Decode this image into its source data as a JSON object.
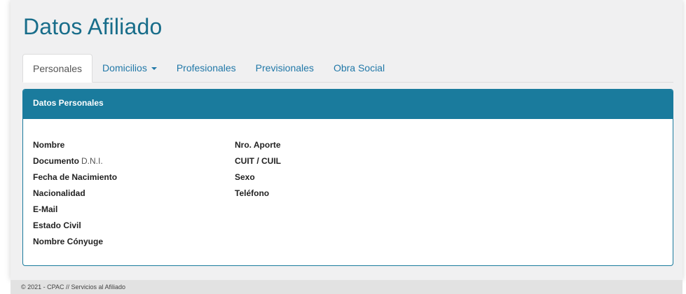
{
  "page": {
    "title": "Datos Afiliado"
  },
  "tabs": [
    {
      "label": "Personales",
      "active": true
    },
    {
      "label": "Domicilios",
      "dropdown": true
    },
    {
      "label": "Profesionales"
    },
    {
      "label": "Previsionales"
    },
    {
      "label": "Obra Social"
    }
  ],
  "panel": {
    "heading": "Datos Personales",
    "left_fields": [
      {
        "label": "Nombre",
        "value": ""
      },
      {
        "label": "Documento",
        "value": "D.N.I."
      },
      {
        "label": "Fecha de Nacimiento",
        "value": ""
      },
      {
        "label": "Nacionalidad",
        "value": ""
      },
      {
        "label": "E-Mail",
        "value": ""
      },
      {
        "label": "Estado Civil",
        "value": ""
      },
      {
        "label": "Nombre Cónyuge",
        "value": ""
      }
    ],
    "right_fields": [
      {
        "label": "Nro. Aporte",
        "value": ""
      },
      {
        "label": "CUIT / CUIL",
        "value": ""
      },
      {
        "label": "Sexo",
        "value": ""
      },
      {
        "label": "Teléfono",
        "value": ""
      }
    ]
  },
  "footer": {
    "text": "© 2021 - CPAC // Servicios al Afiliado"
  },
  "colors": {
    "brand": "#1a7b9d",
    "title": "#186d8a",
    "link": "#2178a8"
  }
}
